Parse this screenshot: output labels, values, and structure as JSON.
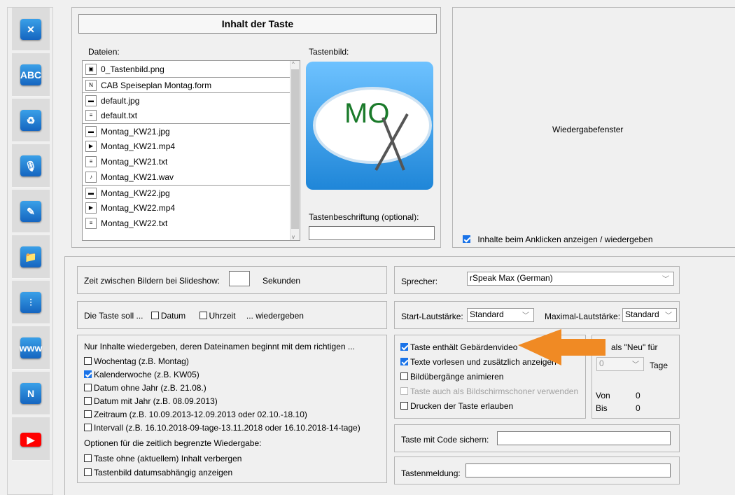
{
  "sidebar": {
    "buttons": [
      {
        "name": "tools-icon",
        "glyph": "✕"
      },
      {
        "name": "abc-eraser-icon",
        "glyph": "ABC"
      },
      {
        "name": "recycle-bin-icon",
        "glyph": "♻"
      },
      {
        "name": "microphone-icon",
        "glyph": "🎙"
      },
      {
        "name": "edit-note-icon",
        "glyph": "✎"
      },
      {
        "name": "folder-icon",
        "glyph": "📁"
      },
      {
        "name": "equalizer-icon",
        "glyph": "⫶"
      },
      {
        "name": "www-globe-icon",
        "glyph": "www"
      },
      {
        "name": "form-ruler-icon",
        "glyph": "N"
      },
      {
        "name": "youtube-icon",
        "glyph": "▶"
      }
    ]
  },
  "content": {
    "title": "Inhalt der Taste",
    "files_label": "Dateien:",
    "image_label": "Tastenbild:",
    "image_text": "MO",
    "caption_label": "Tastenbeschriftung (optional):",
    "caption_value": "",
    "files": [
      {
        "name": "0_Tastenbild.png",
        "type": "png"
      },
      {
        "name": "CAB Speiseplan Montag.form",
        "type": "form"
      },
      {
        "name": "default.jpg",
        "type": "jpg"
      },
      {
        "name": "default.txt",
        "type": "txt"
      },
      {
        "name": "Montag_KW21.jpg",
        "type": "jpg"
      },
      {
        "name": "Montag_KW21.mp4",
        "type": "mp4"
      },
      {
        "name": "Montag_KW21.txt",
        "type": "txt"
      },
      {
        "name": "Montag_KW21.wav",
        "type": "wav"
      },
      {
        "name": "Montag_KW22.jpg",
        "type": "jpg"
      },
      {
        "name": "Montag_KW22.mp4",
        "type": "mp4"
      },
      {
        "name": "Montag_KW22.txt",
        "type": "txt"
      }
    ]
  },
  "playback": {
    "window_label": "Wiedergabefenster",
    "show_on_click_label": "Inhalte beim Anklicken anzeigen / wiedergeben"
  },
  "slideshow": {
    "label": "Zeit zwischen Bildern bei Slideshow:",
    "value": "",
    "unit": "Sekunden"
  },
  "playwith": {
    "prefix": "Die Taste soll ...",
    "date": "Datum",
    "time": "Uhrzeit",
    "suffix": "... wiedergeben"
  },
  "filter": {
    "intro": "Nur Inhalte wiedergeben, deren Dateinamen beginnt mit dem richtigen ...",
    "options": [
      {
        "label": "Wochentag (z.B. Montag)",
        "checked": false
      },
      {
        "label": "Kalenderwoche (z.B. KW05)",
        "checked": true
      },
      {
        "label": "Datum ohne Jahr (z.B. 21.08.)",
        "checked": false
      },
      {
        "label": "Datum mit Jahr (z.B. 08.09.2013)",
        "checked": false
      },
      {
        "label": "Zeitraum (z.B. 10.09.2013-12.09.2013 oder 02.10.-18.10)",
        "checked": false
      },
      {
        "label": "Intervall (z.B. 16.10.2018-09-tage-13.11.2018 oder 16.10.2018-14-tage)",
        "checked": false
      }
    ],
    "options_title": "Optionen für die zeitlich begrenzte Wiedergabe:",
    "options2": [
      {
        "label": "Taste ohne (aktuellem) Inhalt verbergen",
        "checked": false
      },
      {
        "label": "Tastenbild datumsabhängig anzeigen",
        "checked": false
      }
    ]
  },
  "speaker": {
    "label": "Sprecher:",
    "value": "rSpeak Max (German)"
  },
  "volume": {
    "start_label": "Start-Lautstärke:",
    "start_value": "Standard",
    "max_label": "Maximal-Lautstärke:",
    "max_value": "Standard"
  },
  "options": [
    {
      "label": "Taste enthält Gebärdenvideo",
      "checked": true,
      "disabled": false
    },
    {
      "label": "Texte vorlesen und zusätzlich anzeigen",
      "checked": true,
      "disabled": false
    },
    {
      "label": "Bildübergänge animieren",
      "checked": false,
      "disabled": false
    },
    {
      "label": "Taste auch als Bildschirmschoner verwenden",
      "checked": false,
      "disabled": true
    },
    {
      "label": "Drucken der Taste erlauben",
      "checked": false,
      "disabled": false
    }
  ],
  "neu": {
    "title": "als \"Neu\" für",
    "days_value": "0",
    "days_label": "Tage",
    "von_label": "Von",
    "von_value": "0",
    "bis_label": "Bis",
    "bis_value": "0"
  },
  "code": {
    "label": "Taste mit Code sichern:",
    "value": ""
  },
  "message": {
    "label": "Tastenmeldung:",
    "value": ""
  },
  "colors": {
    "arrow": "#f08a24",
    "accent": "#1a73e8"
  }
}
